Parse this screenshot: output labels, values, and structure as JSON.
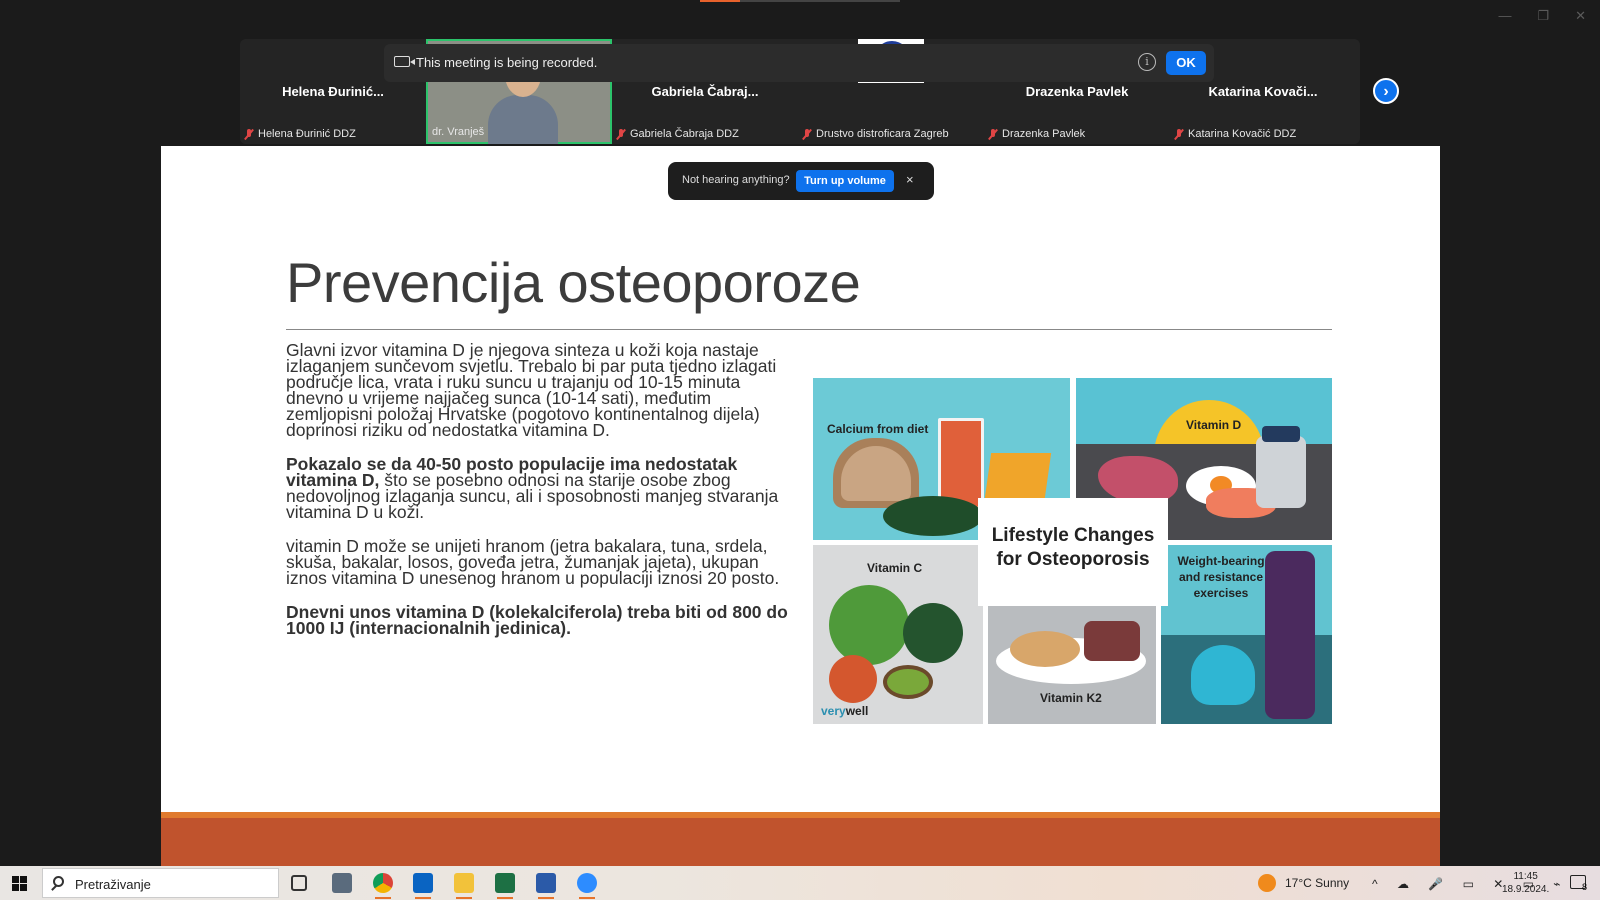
{
  "window": {
    "controls": [
      "—",
      "❐",
      "✕"
    ]
  },
  "recording_banner": {
    "message": "This meeting is being recorded.",
    "ok_label": "OK",
    "info_glyph": "i"
  },
  "participants": [
    {
      "name": "Helena  Đurinić...",
      "label": "Helena Đurinić DDZ",
      "type": "name"
    },
    {
      "name": "",
      "label": "dr. Vranješ",
      "type": "video"
    },
    {
      "name": "Gabriela  Čabraj...",
      "label": "Gabriela Čabraja DDZ",
      "type": "name"
    },
    {
      "name": "",
      "label": "Drustvo distroficara Zagreb",
      "type": "logo"
    },
    {
      "name": "Drazenka Pavlek",
      "label": "Drazenka Pavlek",
      "type": "name"
    },
    {
      "name": "Katarina  Kovači...",
      "label": "Katarina Kovačić DDZ",
      "type": "name"
    }
  ],
  "volume_toast": {
    "question": "Not hearing anything?",
    "button": "Turn up volume",
    "close": "×"
  },
  "slide": {
    "title": "Prevencija osteoporoze",
    "paragraphs": [
      {
        "bold": "",
        "text": "Glavni izvor vitamina D je njegova sinteza u koži koja nastaje izlaganjem sunčevom svjetlu. Trebalo bi par puta tjedno izlagati područje lica, vrata i ruku suncu u trajanju od 10-15 minuta dnevno u vrijeme najjačeg sunca (10-14 sati), međutim zemljopisni položaj Hrvatske (pogotovo kontinentalnog dijela) doprinosi riziku od nedostatka vitamina D."
      },
      {
        "bold": "Pokazalo se da 40-50 posto populacije ima nedostatak vitamina D,",
        "text": " što se posebno odnosi na starije osobe zbog nedovoljnog izlaganja suncu, ali i sposobnosti manjeg stvaranja vitamina D u koži."
      },
      {
        "bold": "",
        "text": "vitamin D može se unijeti hranom (jetra bakalara, tuna, srdela, skuša, bakalar,  losos, goveđa jetra, žumanjak jajeta), ukupan iznos vitamina D unesenog hranom u populaciji iznosi 20 posto."
      },
      {
        "bold": "Dnevni unos vitamina D (kolekalciferola) treba biti od 800 do 1000 IJ (internacionalnih jedinica).",
        "text": ""
      }
    ],
    "infographic": {
      "center_title": "Lifestyle Changes for Osteoporosis",
      "calcium": "Calcium from diet",
      "vitamin_d": "Vitamin D",
      "vitamin_c": "Vitamin C",
      "vitamin_k2": "Vitamin K2",
      "weight": "Weight-bearing and resistance exercises",
      "brand_a": "very",
      "brand_b": "well"
    }
  },
  "taskbar": {
    "search_placeholder": "Pretraživanje",
    "weather": "17°C  Sunny",
    "time": "11:45",
    "date": "18.9.2024.",
    "notif_count": "8"
  }
}
